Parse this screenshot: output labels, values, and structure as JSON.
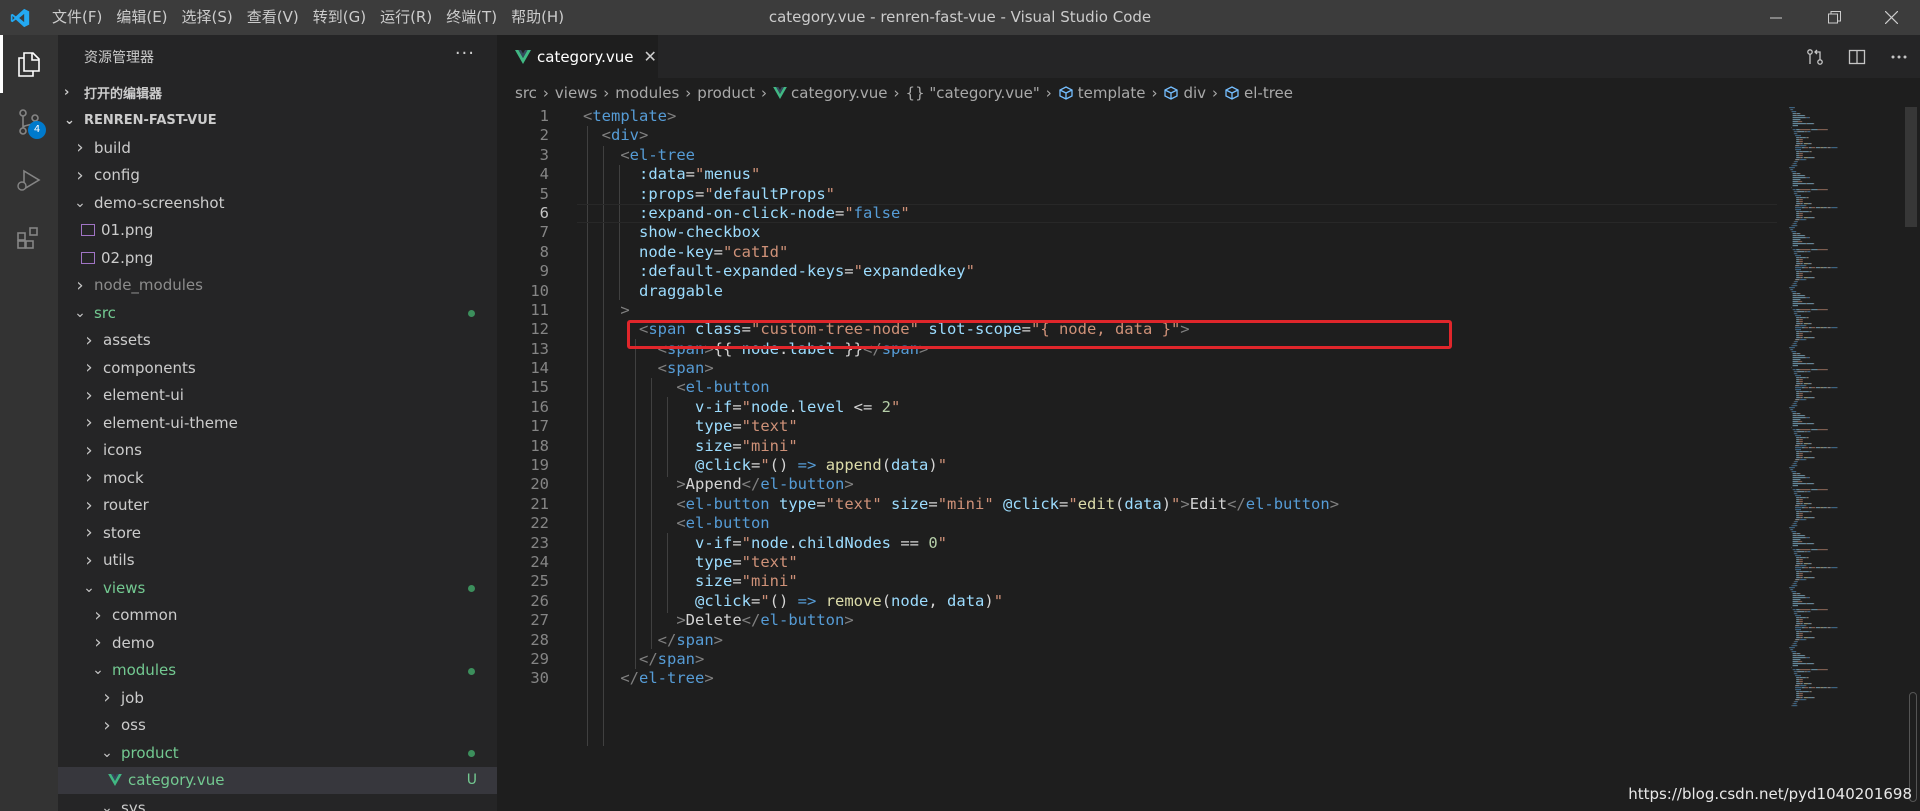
{
  "titlebar": {
    "menu": [
      "文件(F)",
      "编辑(E)",
      "选择(S)",
      "查看(V)",
      "转到(G)",
      "运行(R)",
      "终端(T)",
      "帮助(H)"
    ],
    "window_title": "category.vue - renren-fast-vue - Visual Studio Code",
    "controls": {
      "minimize": "minimize-icon",
      "restore": "restore-icon",
      "close": "close-icon"
    }
  },
  "activity": {
    "items": [
      "explorer-icon",
      "source-control-icon",
      "run-debug-icon",
      "extensions-icon"
    ],
    "scm_badge": "4"
  },
  "sidebar": {
    "title": "资源管理器",
    "more": "···",
    "open_editors": "打开的编辑器",
    "project": "RENREN-FAST-VUE",
    "tree": [
      {
        "label": "build",
        "type": "folder",
        "depth": 1
      },
      {
        "label": "config",
        "type": "folder",
        "depth": 1
      },
      {
        "label": "demo-screenshot",
        "type": "folder-open",
        "depth": 1
      },
      {
        "label": "01.png",
        "type": "image",
        "depth": 2
      },
      {
        "label": "02.png",
        "type": "image",
        "depth": 2
      },
      {
        "label": "node_modules",
        "type": "folder",
        "depth": 1,
        "dim": true
      },
      {
        "label": "src",
        "type": "folder-open",
        "depth": 1,
        "git": true
      },
      {
        "label": "assets",
        "type": "folder",
        "depth": 2
      },
      {
        "label": "components",
        "type": "folder",
        "depth": 2
      },
      {
        "label": "element-ui",
        "type": "folder",
        "depth": 2
      },
      {
        "label": "element-ui-theme",
        "type": "folder",
        "depth": 2
      },
      {
        "label": "icons",
        "type": "folder",
        "depth": 2
      },
      {
        "label": "mock",
        "type": "folder",
        "depth": 2
      },
      {
        "label": "router",
        "type": "folder",
        "depth": 2
      },
      {
        "label": "store",
        "type": "folder",
        "depth": 2
      },
      {
        "label": "utils",
        "type": "folder",
        "depth": 2
      },
      {
        "label": "views",
        "type": "folder-open",
        "depth": 2,
        "git": true
      },
      {
        "label": "common",
        "type": "folder",
        "depth": 3
      },
      {
        "label": "demo",
        "type": "folder",
        "depth": 3
      },
      {
        "label": "modules",
        "type": "folder-open",
        "depth": 3,
        "git": true
      },
      {
        "label": "job",
        "type": "folder",
        "depth": 4
      },
      {
        "label": "oss",
        "type": "folder",
        "depth": 4
      },
      {
        "label": "product",
        "type": "folder-open",
        "depth": 4,
        "git": true
      },
      {
        "label": "category.vue",
        "type": "vue",
        "depth": 5,
        "git": true,
        "selected": true,
        "badge": "U"
      },
      {
        "label": "sys",
        "type": "folder-open",
        "depth": 4
      }
    ]
  },
  "editor": {
    "tab": {
      "label": "category.vue",
      "close": "✕"
    },
    "actions": [
      "open-changes-icon",
      "split-editor-icon",
      "more-actions-icon"
    ],
    "breadcrumb": [
      "src",
      "views",
      "modules",
      "product",
      "category.vue",
      "{} \"category.vue\"",
      "template",
      "div",
      "el-tree"
    ],
    "lines": [
      [
        [
          "<",
          "t-punct"
        ],
        [
          "template",
          "t-tag"
        ],
        [
          ">",
          "t-punct"
        ]
      ],
      [
        [
          "  <",
          "t-punct"
        ],
        [
          "div",
          "t-tag"
        ],
        [
          ">",
          "t-punct"
        ]
      ],
      [
        [
          "    <",
          "t-punct"
        ],
        [
          "el-tree",
          "t-tag"
        ]
      ],
      [
        [
          "      :data",
          "t-attr"
        ],
        [
          "=",
          "t-text"
        ],
        [
          "\"",
          "t-str"
        ],
        [
          "menus",
          "t-attr"
        ],
        [
          "\"",
          "t-str"
        ]
      ],
      [
        [
          "      :props",
          "t-attr"
        ],
        [
          "=",
          "t-text"
        ],
        [
          "\"",
          "t-str"
        ],
        [
          "defaultProps",
          "t-attr"
        ],
        [
          "\"",
          "t-str"
        ]
      ],
      [
        [
          "      :expand-on-click-node",
          "t-attr"
        ],
        [
          "=",
          "t-text"
        ],
        [
          "\"",
          "t-str"
        ],
        [
          "false",
          "t-kw"
        ],
        [
          "\"",
          "t-str"
        ]
      ],
      [
        [
          "      show-checkbox",
          "t-attr"
        ]
      ],
      [
        [
          "      node-key",
          "t-attr"
        ],
        [
          "=",
          "t-text"
        ],
        [
          "\"catId\"",
          "t-str"
        ]
      ],
      [
        [
          "      :default-expanded-keys",
          "t-attr"
        ],
        [
          "=",
          "t-text"
        ],
        [
          "\"",
          "t-str"
        ],
        [
          "expandedkey",
          "t-attr"
        ],
        [
          "\"",
          "t-str"
        ]
      ],
      [
        [
          "      draggable",
          "t-attr"
        ]
      ],
      [
        [
          "    >",
          "t-punct"
        ]
      ],
      [
        [
          "      <",
          "t-punct"
        ],
        [
          "span",
          "t-tag"
        ],
        [
          " class",
          "t-attr"
        ],
        [
          "=",
          "t-text"
        ],
        [
          "\"custom-tree-node\"",
          "t-str"
        ],
        [
          " slot-scope",
          "t-attr"
        ],
        [
          "=",
          "t-text"
        ],
        [
          "\"{ node, data }\"",
          "t-str"
        ],
        [
          ">",
          "t-punct"
        ]
      ],
      [
        [
          "        <",
          "t-punct"
        ],
        [
          "span",
          "t-tag"
        ],
        [
          ">",
          "t-punct"
        ],
        [
          "{{ ",
          "t-text"
        ],
        [
          "node",
          "t-attr"
        ],
        [
          ".",
          "t-text"
        ],
        [
          "label",
          "t-attr"
        ],
        [
          " }}",
          "t-text"
        ],
        [
          "</",
          "t-punct"
        ],
        [
          "span",
          "t-tag"
        ],
        [
          ">",
          "t-punct"
        ]
      ],
      [
        [
          "        <",
          "t-punct"
        ],
        [
          "span",
          "t-tag"
        ],
        [
          ">",
          "t-punct"
        ]
      ],
      [
        [
          "          <",
          "t-punct"
        ],
        [
          "el-button",
          "t-tag"
        ]
      ],
      [
        [
          "            v-if",
          "t-attr"
        ],
        [
          "=",
          "t-text"
        ],
        [
          "\"",
          "t-str"
        ],
        [
          "node",
          "t-attr"
        ],
        [
          ".",
          "t-text"
        ],
        [
          "level",
          "t-attr"
        ],
        [
          " <= ",
          "t-text"
        ],
        [
          "2",
          "t-num"
        ],
        [
          "\"",
          "t-str"
        ]
      ],
      [
        [
          "            type",
          "t-attr"
        ],
        [
          "=",
          "t-text"
        ],
        [
          "\"text\"",
          "t-str"
        ]
      ],
      [
        [
          "            size",
          "t-attr"
        ],
        [
          "=",
          "t-text"
        ],
        [
          "\"mini\"",
          "t-str"
        ]
      ],
      [
        [
          "            @click",
          "t-attr"
        ],
        [
          "=",
          "t-text"
        ],
        [
          "\"",
          "t-str"
        ],
        [
          "() ",
          "t-text"
        ],
        [
          "=>",
          "t-kw"
        ],
        [
          " ",
          "t-text"
        ],
        [
          "append",
          "t-fn"
        ],
        [
          "(",
          "t-text"
        ],
        [
          "data",
          "t-attr"
        ],
        [
          ")",
          "t-text"
        ],
        [
          "\"",
          "t-str"
        ]
      ],
      [
        [
          "          >",
          "t-punct"
        ],
        [
          "Append",
          "t-text"
        ],
        [
          "</",
          "t-punct"
        ],
        [
          "el-button",
          "t-tag"
        ],
        [
          ">",
          "t-punct"
        ]
      ],
      [
        [
          "          <",
          "t-punct"
        ],
        [
          "el-button",
          "t-tag"
        ],
        [
          " type",
          "t-attr"
        ],
        [
          "=",
          "t-text"
        ],
        [
          "\"text\"",
          "t-str"
        ],
        [
          " size",
          "t-attr"
        ],
        [
          "=",
          "t-text"
        ],
        [
          "\"mini\"",
          "t-str"
        ],
        [
          " @click",
          "t-attr"
        ],
        [
          "=",
          "t-text"
        ],
        [
          "\"",
          "t-str"
        ],
        [
          "edit",
          "t-fn"
        ],
        [
          "(",
          "t-text"
        ],
        [
          "data",
          "t-attr"
        ],
        [
          ")",
          "t-text"
        ],
        [
          "\"",
          "t-str"
        ],
        [
          ">",
          "t-punct"
        ],
        [
          "Edit",
          "t-text"
        ],
        [
          "</",
          "t-punct"
        ],
        [
          "el-button",
          "t-tag"
        ],
        [
          ">",
          "t-punct"
        ]
      ],
      [
        [
          "          <",
          "t-punct"
        ],
        [
          "el-button",
          "t-tag"
        ]
      ],
      [
        [
          "            v-if",
          "t-attr"
        ],
        [
          "=",
          "t-text"
        ],
        [
          "\"",
          "t-str"
        ],
        [
          "node",
          "t-attr"
        ],
        [
          ".",
          "t-text"
        ],
        [
          "childNodes",
          "t-attr"
        ],
        [
          " == ",
          "t-text"
        ],
        [
          "0",
          "t-num"
        ],
        [
          "\"",
          "t-str"
        ]
      ],
      [
        [
          "            type",
          "t-attr"
        ],
        [
          "=",
          "t-text"
        ],
        [
          "\"text\"",
          "t-str"
        ]
      ],
      [
        [
          "            size",
          "t-attr"
        ],
        [
          "=",
          "t-text"
        ],
        [
          "\"mini\"",
          "t-str"
        ]
      ],
      [
        [
          "            @click",
          "t-attr"
        ],
        [
          "=",
          "t-text"
        ],
        [
          "\"",
          "t-str"
        ],
        [
          "() ",
          "t-text"
        ],
        [
          "=>",
          "t-kw"
        ],
        [
          " ",
          "t-text"
        ],
        [
          "remove",
          "t-fn"
        ],
        [
          "(",
          "t-text"
        ],
        [
          "node",
          "t-attr"
        ],
        [
          ", ",
          "t-text"
        ],
        [
          "data",
          "t-attr"
        ],
        [
          ")",
          "t-text"
        ],
        [
          "\"",
          "t-str"
        ]
      ],
      [
        [
          "          >",
          "t-punct"
        ],
        [
          "Delete",
          "t-text"
        ],
        [
          "</",
          "t-punct"
        ],
        [
          "el-button",
          "t-tag"
        ],
        [
          ">",
          "t-punct"
        ]
      ],
      [
        [
          "        </",
          "t-punct"
        ],
        [
          "span",
          "t-tag"
        ],
        [
          ">",
          "t-punct"
        ]
      ],
      [
        [
          "      </",
          "t-punct"
        ],
        [
          "span",
          "t-tag"
        ],
        [
          ">",
          "t-punct"
        ]
      ],
      [
        [
          "    </",
          "t-punct"
        ],
        [
          "el-tree",
          "t-tag"
        ],
        [
          ">",
          "t-punct"
        ]
      ]
    ],
    "current_line": 6,
    "highlighted_line": 10
  },
  "watermark": "https://blog.csdn.net/pyd1040201698"
}
